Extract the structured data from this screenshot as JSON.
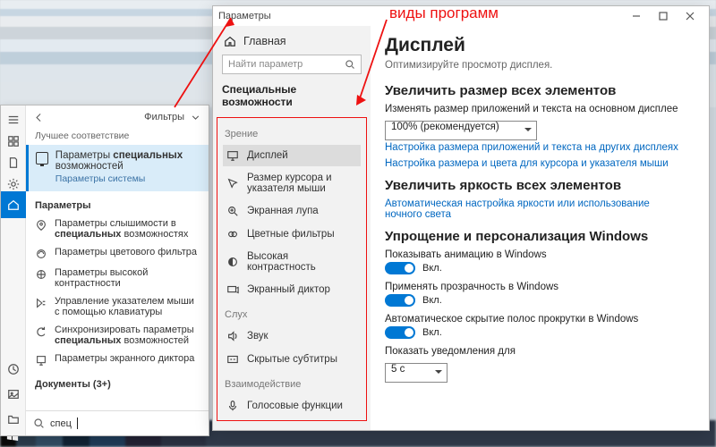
{
  "annotation_label": "виды программ",
  "settings": {
    "window_title": "Параметры",
    "home_label": "Главная",
    "search_placeholder": "Найти параметр",
    "category": "Специальные возможности",
    "groups": {
      "vision": "Зрение",
      "hearing": "Слух",
      "interaction": "Взаимодействие"
    },
    "nav": {
      "display": "Дисплей",
      "cursor": "Размер курсора и указателя мыши",
      "magnifier": "Экранная лупа",
      "color_filters": "Цветные фильтры",
      "high_contrast": "Высокая контрастность",
      "narrator": "Экранный диктор",
      "sound": "Звук",
      "captions": "Скрытые субтитры",
      "speech": "Голосовые функции"
    },
    "page": {
      "title": "Дисплей",
      "subtitle": "Оптимизируйте просмотр дисплея.",
      "h_scale": "Увеличить размер всех элементов",
      "scale_desc": "Изменять размер приложений и текста на основном дисплее",
      "scale_value": "100% (рекомендуется)",
      "link_scale_other": "Настройка размера приложений и текста на других дисплеях",
      "link_cursor": "Настройка размера и цвета для курсора и указателя мыши",
      "h_bright": "Увеличить яркость всех элементов",
      "link_bright": "Автоматическая настройка яркости или использование ночного света",
      "h_simplify": "Упрощение и персонализация Windows",
      "t_anim": "Показывать анимацию в Windows",
      "t_trans": "Применять прозрачность в Windows",
      "t_scroll": "Автоматическое скрытие полос прокрутки в Windows",
      "on": "Вкл.",
      "notif_label": "Показать уведомления для",
      "notif_value": "5 с"
    }
  },
  "start": {
    "filters_label": "Фильтры",
    "best_match": "Лучшее соответствие",
    "result_title_a": "Параметры ",
    "result_title_b": "специальных",
    "result_title_c": " возможностей",
    "result_sub": "Параметры системы",
    "section": "Параметры",
    "items": [
      "Параметры слышимости в специальных возможностях",
      "Параметры цветового фильтра",
      "Параметры высокой контрастности",
      "Управление указателем мыши с помощью клавиатуры",
      "Синхронизировать параметры специальных возможностей",
      "Параметры экранного диктора"
    ],
    "bold_items": [
      "специальных",
      "",
      "",
      "",
      "специальных",
      ""
    ],
    "documents": "Документы (3+)",
    "query": "спец"
  }
}
